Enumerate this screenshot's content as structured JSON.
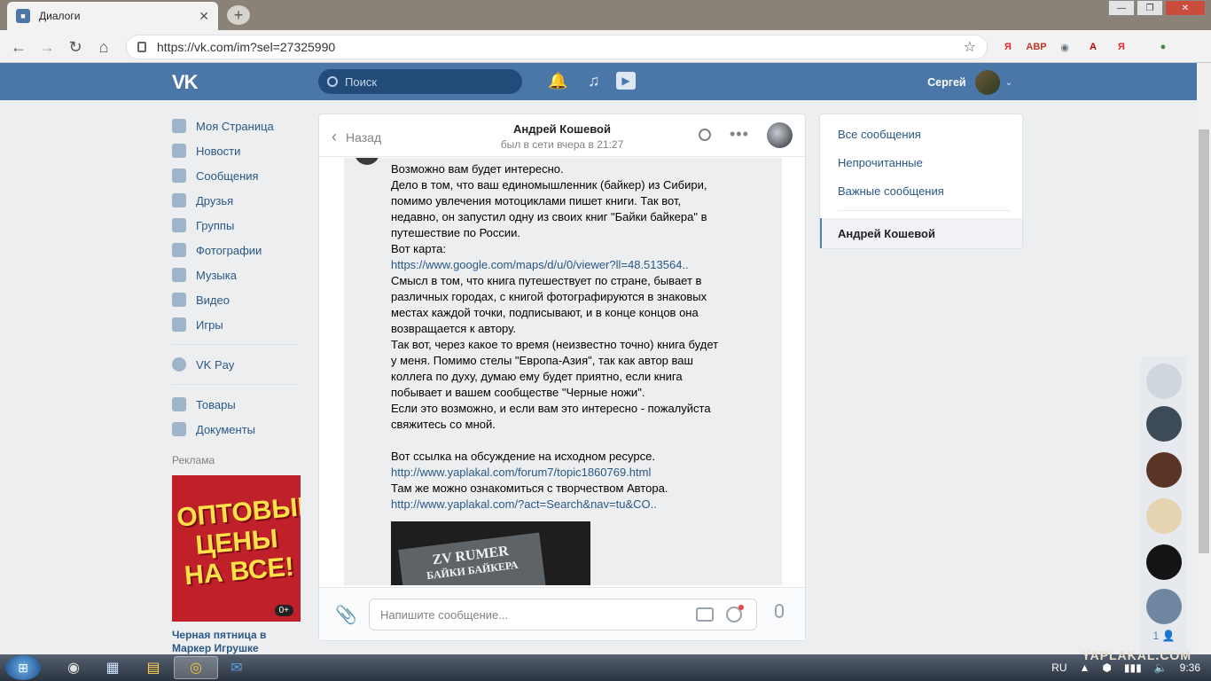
{
  "browser": {
    "tab_title": "Диалоги",
    "url": "https://vk.com/im?sel=27325990",
    "new_tab": "+",
    "tab_close": "✕",
    "star": "☆",
    "window_controls": {
      "minimize": "—",
      "maximize": "❐",
      "close": "✕"
    },
    "extensions": [
      {
        "name": "yandex-icon",
        "label": "Я",
        "color": "#e32a2a"
      },
      {
        "name": "adblock-icon",
        "label": "ABP",
        "color": "#c0392b"
      },
      {
        "name": "vpn-icon",
        "label": "◉",
        "color": "#607080"
      },
      {
        "name": "pdf-icon",
        "label": "A",
        "color": "#c00000"
      },
      {
        "name": "yandex-red-icon",
        "label": "Я",
        "color": "#e32a2a"
      },
      {
        "name": "profile-icon",
        "label": "●",
        "color": "#3c8c3c"
      }
    ]
  },
  "header": {
    "logo": "VK",
    "search_placeholder": "Поиск",
    "user_name": "Сергей"
  },
  "left_menu": {
    "items": [
      {
        "label": "Моя Страница",
        "icon": "home-icon"
      },
      {
        "label": "Новости",
        "icon": "news-icon"
      },
      {
        "label": "Сообщения",
        "icon": "messages-icon"
      },
      {
        "label": "Друзья",
        "icon": "friends-icon"
      },
      {
        "label": "Группы",
        "icon": "groups-icon"
      },
      {
        "label": "Фотографии",
        "icon": "photos-icon"
      },
      {
        "label": "Музыка",
        "icon": "music-icon"
      },
      {
        "label": "Видео",
        "icon": "video-icon"
      },
      {
        "label": "Игры",
        "icon": "games-icon"
      }
    ],
    "pay": {
      "label": "VK Pay",
      "icon": "vkpay-icon"
    },
    "extra": [
      {
        "label": "Товары",
        "icon": "goods-icon"
      },
      {
        "label": "Документы",
        "icon": "docs-icon"
      }
    ],
    "ads_title": "Реклама",
    "ad_text": "ОПТОВЫЕ ЦЕНЫ НА ВСЕ!",
    "ad_age": "0+",
    "ad_caption": "Черная пятница в Маркер Игрушке"
  },
  "chat": {
    "back_label": "Назад",
    "peer_name": "Андрей Кошевой",
    "peer_status": "был в сети вчера в 21:27",
    "message_lines": [
      {
        "t": "Возможно вам будет интересно.",
        "link": false
      },
      {
        "t": "Дело в том, что ваш единомышленник (байкер) из Сибири,",
        "link": false
      },
      {
        "t": "помимо увлечения мотоциклами пишет книги. Так вот,",
        "link": false
      },
      {
        "t": "недавно, он запустил одну из своих книг \"Байки байкера\" в",
        "link": false
      },
      {
        "t": "путешествие по России.",
        "link": false
      },
      {
        "t": "Вот карта:",
        "link": false
      },
      {
        "t": "https://www.google.com/maps/d/u/0/viewer?ll=48.513564..",
        "link": true
      },
      {
        "t": "Смысл в том, что книга путешествует по стране, бывает в",
        "link": false
      },
      {
        "t": "различных городах, с книгой фотографируются в знаковых",
        "link": false
      },
      {
        "t": "местах каждой точки, подписывают, и в конце концов она",
        "link": false
      },
      {
        "t": "возвращается к автору.",
        "link": false
      },
      {
        "t": "Так вот, через какое то время (неизвестно точно) книга будет",
        "link": false
      },
      {
        "t": "у меня. Помимо стелы \"Европа-Азия\", так как автор ваш",
        "link": false
      },
      {
        "t": "коллега по духу, думаю ему будет приятно, если книга",
        "link": false
      },
      {
        "t": "побывает и вашем сообществе \"Черные ножи\".",
        "link": false
      },
      {
        "t": "Если это возможно, и если вам это интересно - пожалуйста",
        "link": false
      },
      {
        "t": "свяжитесь со мной.",
        "link": false
      },
      {
        "t": "",
        "link": false
      },
      {
        "t": "Вот ссылка на обсуждение на исходном ресурсе.",
        "link": false
      },
      {
        "t": "http://www.yaplakal.com/forum7/topic1860769.html",
        "link": true
      },
      {
        "t": "Там же можно ознакомиться с творчеством Автора.",
        "link": false
      },
      {
        "t": "http://www.yaplakal.com/?act=Search&nav=tu&CO..",
        "link": true
      }
    ],
    "photo_title": "ZV RUMER",
    "photo_subtitle": "БАЙКИ БАЙКЕРА",
    "composer_placeholder": "Напишите сообщение..."
  },
  "right_panel": {
    "items": [
      "Все сообщения",
      "Непрочитанные",
      "Важные сообщения"
    ],
    "active": "Андрей Кошевой"
  },
  "friends_bar": {
    "count": "1",
    "avatars": [
      "#cfd6dd",
      "#3d4a57",
      "#5a3526",
      "#e6d3b0",
      "#141414",
      "#6e86a0"
    ]
  },
  "taskbar": {
    "lang": "RU",
    "time": "9:36",
    "watermark": "YAPLAKAL.COM"
  }
}
